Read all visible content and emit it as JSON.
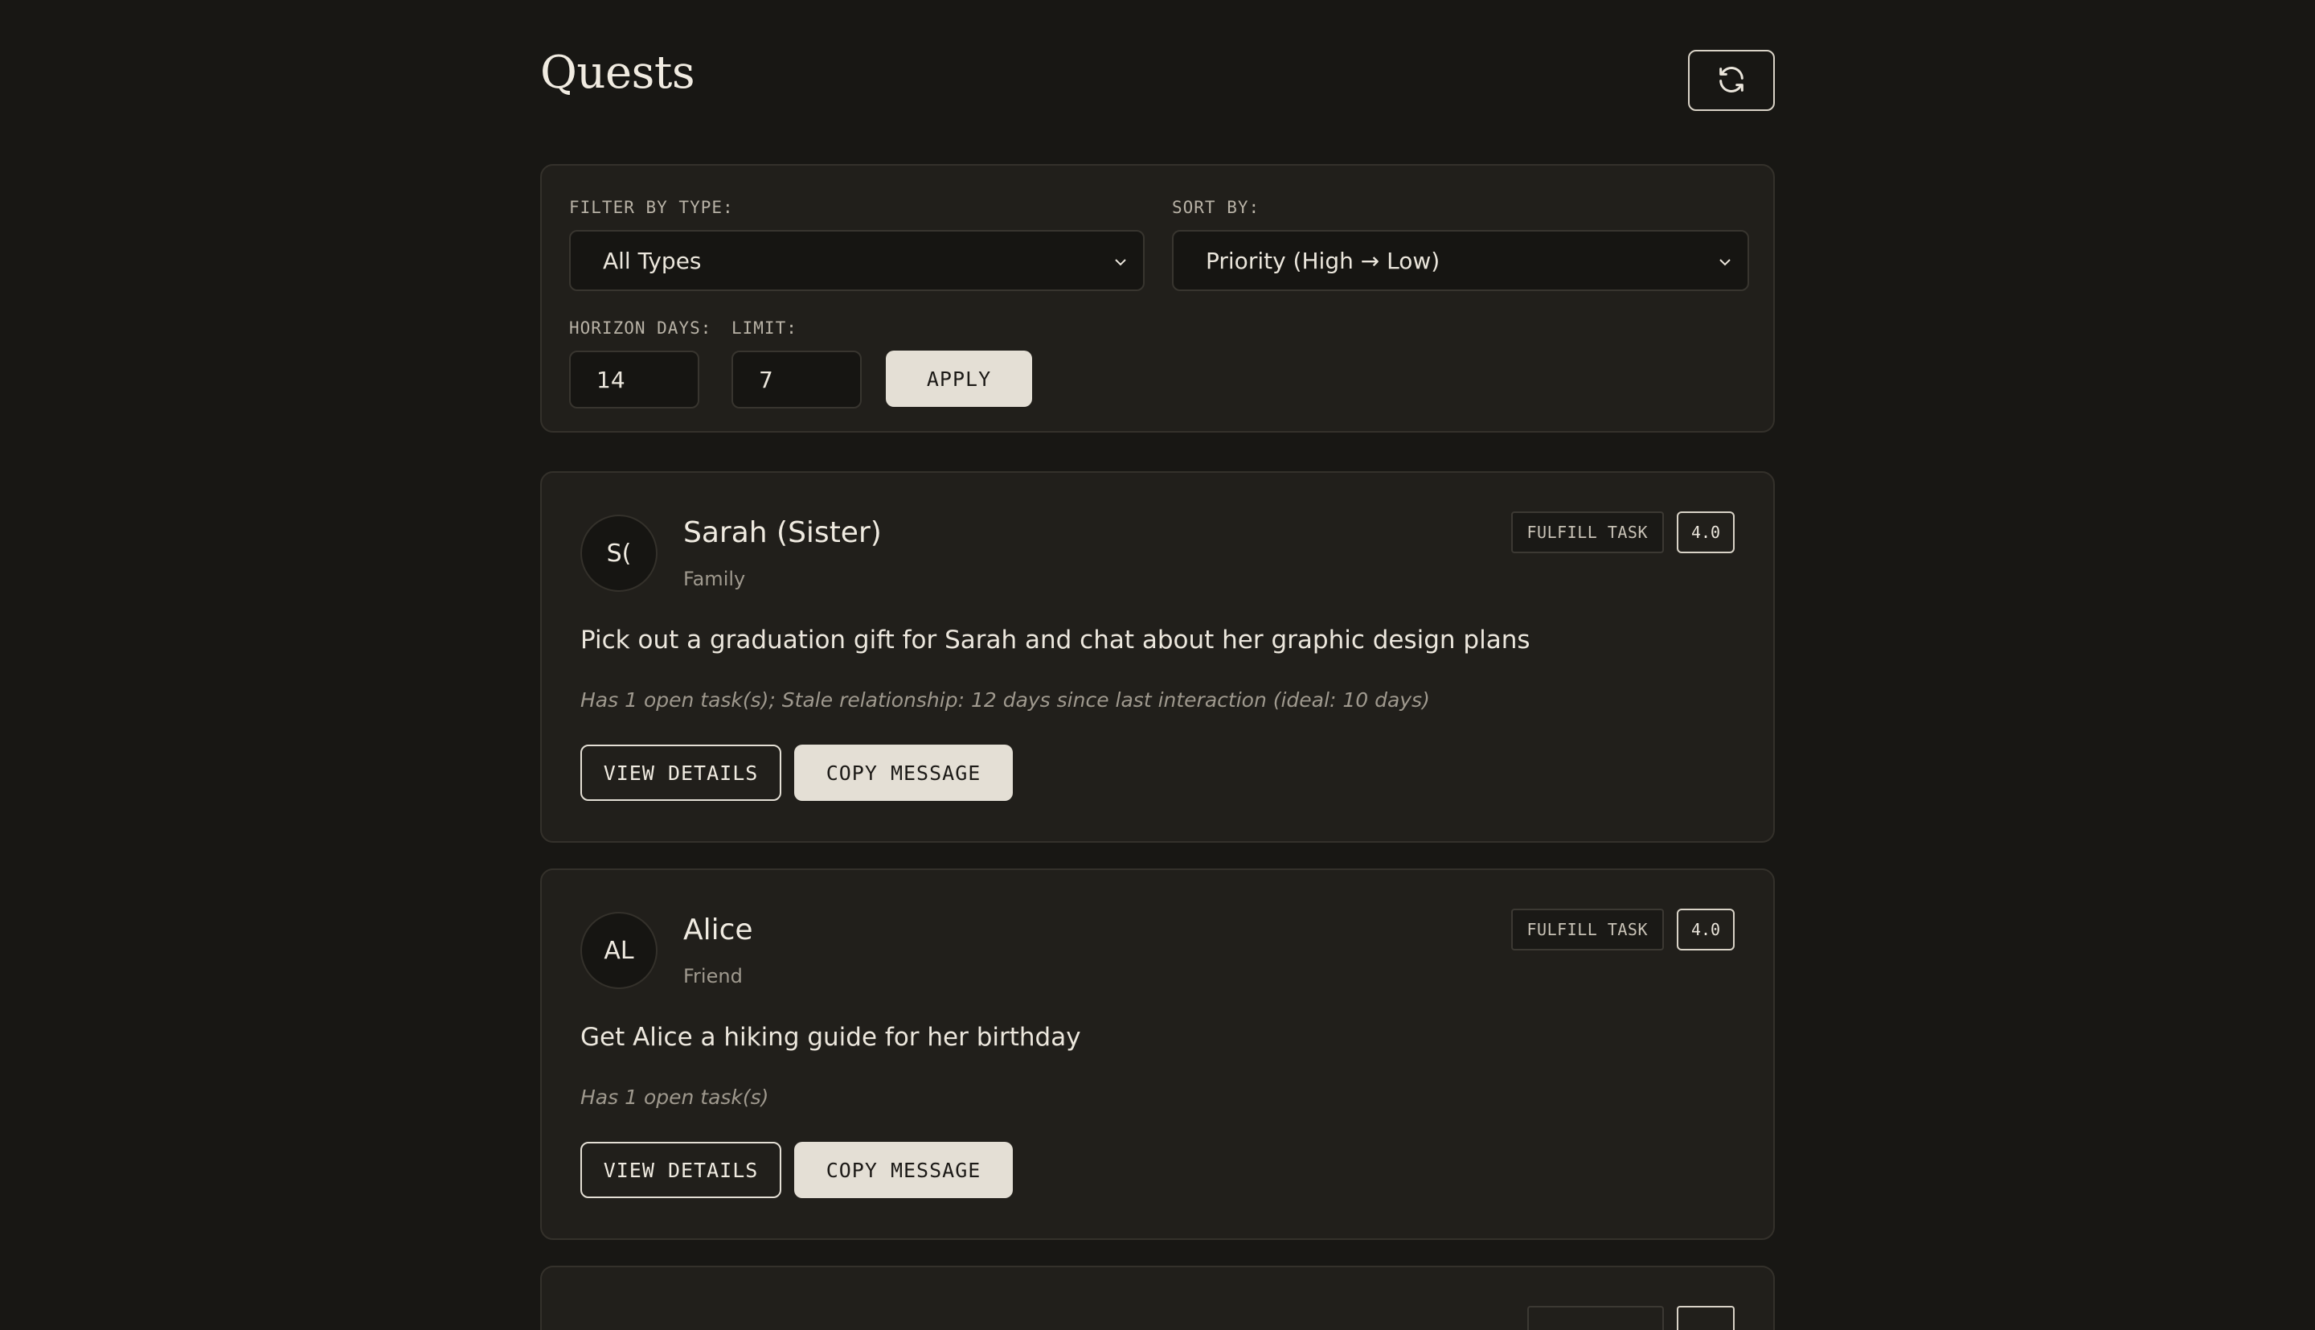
{
  "header": {
    "title": "Quests",
    "refresh_icon": "refresh-icon"
  },
  "filters": {
    "type_label": "FILTER BY TYPE:",
    "type_value": "All Types",
    "sort_label": "SORT BY:",
    "sort_value": "Priority (High → Low)",
    "horizon_label": "HORIZON DAYS:",
    "horizon_value": "14",
    "limit_label": "LIMIT:",
    "limit_value": "7",
    "apply_label": "APPLY"
  },
  "quests": [
    {
      "initials": "S(",
      "name": "Sarah (Sister)",
      "role": "Family",
      "type": "FULFILL TASK",
      "score": "4.0",
      "description": "Pick out a graduation gift for Sarah and chat about her graphic design plans",
      "reason": "Has 1 open task(s); Stale relationship: 12 days since last interaction (ideal: 10 days)",
      "view_label": "VIEW DETAILS",
      "copy_label": "COPY MESSAGE"
    },
    {
      "initials": "AL",
      "name": "Alice",
      "role": "Friend",
      "type": "FULFILL TASK",
      "score": "4.0",
      "description": "Get Alice a hiking guide for her birthday",
      "reason": "Has 1 open task(s)",
      "view_label": "VIEW DETAILS",
      "copy_label": "COPY MESSAGE"
    }
  ],
  "colors": {
    "background": "#181714",
    "panel": "#211f1b",
    "accent_button": "#e4dfd5"
  }
}
